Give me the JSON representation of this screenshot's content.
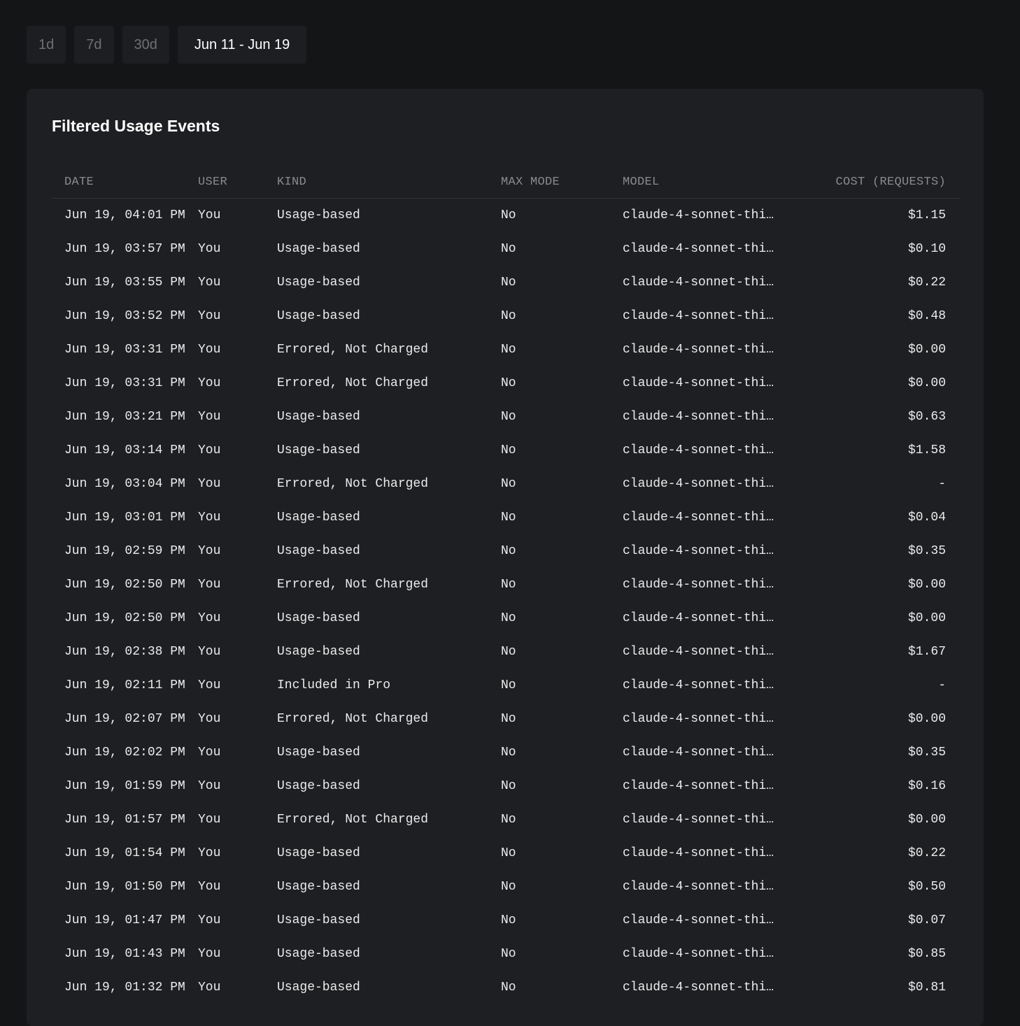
{
  "range_buttons": [
    {
      "label": "1d"
    },
    {
      "label": "7d"
    },
    {
      "label": "30d"
    },
    {
      "label": "Jun 11 - Jun 19"
    }
  ],
  "card": {
    "title": "Filtered Usage Events"
  },
  "table": {
    "headers": {
      "date": "DATE",
      "user": "USER",
      "kind": "KIND",
      "max_mode": "MAX MODE",
      "model": "MODEL",
      "cost": "COST (REQUESTS)"
    },
    "rows": [
      {
        "date": "Jun 19, 04:01 PM",
        "user": "You",
        "kind": "Usage-based",
        "max_mode": "No",
        "model": "claude-4-sonnet-thi…",
        "cost": "$1.15"
      },
      {
        "date": "Jun 19, 03:57 PM",
        "user": "You",
        "kind": "Usage-based",
        "max_mode": "No",
        "model": "claude-4-sonnet-thi…",
        "cost": "$0.10"
      },
      {
        "date": "Jun 19, 03:55 PM",
        "user": "You",
        "kind": "Usage-based",
        "max_mode": "No",
        "model": "claude-4-sonnet-thi…",
        "cost": "$0.22"
      },
      {
        "date": "Jun 19, 03:52 PM",
        "user": "You",
        "kind": "Usage-based",
        "max_mode": "No",
        "model": "claude-4-sonnet-thi…",
        "cost": "$0.48"
      },
      {
        "date": "Jun 19, 03:31 PM",
        "user": "You",
        "kind": "Errored, Not Charged",
        "max_mode": "No",
        "model": "claude-4-sonnet-thi…",
        "cost": "$0.00"
      },
      {
        "date": "Jun 19, 03:31 PM",
        "user": "You",
        "kind": "Errored, Not Charged",
        "max_mode": "No",
        "model": "claude-4-sonnet-thi…",
        "cost": "$0.00"
      },
      {
        "date": "Jun 19, 03:21 PM",
        "user": "You",
        "kind": "Usage-based",
        "max_mode": "No",
        "model": "claude-4-sonnet-thi…",
        "cost": "$0.63"
      },
      {
        "date": "Jun 19, 03:14 PM",
        "user": "You",
        "kind": "Usage-based",
        "max_mode": "No",
        "model": "claude-4-sonnet-thi…",
        "cost": "$1.58"
      },
      {
        "date": "Jun 19, 03:04 PM",
        "user": "You",
        "kind": "Errored, Not Charged",
        "max_mode": "No",
        "model": "claude-4-sonnet-thi…",
        "cost": "-"
      },
      {
        "date": "Jun 19, 03:01 PM",
        "user": "You",
        "kind": "Usage-based",
        "max_mode": "No",
        "model": "claude-4-sonnet-thi…",
        "cost": "$0.04"
      },
      {
        "date": "Jun 19, 02:59 PM",
        "user": "You",
        "kind": "Usage-based",
        "max_mode": "No",
        "model": "claude-4-sonnet-thi…",
        "cost": "$0.35"
      },
      {
        "date": "Jun 19, 02:50 PM",
        "user": "You",
        "kind": "Errored, Not Charged",
        "max_mode": "No",
        "model": "claude-4-sonnet-thi…",
        "cost": "$0.00"
      },
      {
        "date": "Jun 19, 02:50 PM",
        "user": "You",
        "kind": "Usage-based",
        "max_mode": "No",
        "model": "claude-4-sonnet-thi…",
        "cost": "$0.00"
      },
      {
        "date": "Jun 19, 02:38 PM",
        "user": "You",
        "kind": "Usage-based",
        "max_mode": "No",
        "model": "claude-4-sonnet-thi…",
        "cost": "$1.67"
      },
      {
        "date": "Jun 19, 02:11 PM",
        "user": "You",
        "kind": "Included in Pro",
        "max_mode": "No",
        "model": "claude-4-sonnet-thi…",
        "cost": "-"
      },
      {
        "date": "Jun 19, 02:07 PM",
        "user": "You",
        "kind": "Errored, Not Charged",
        "max_mode": "No",
        "model": "claude-4-sonnet-thi…",
        "cost": "$0.00"
      },
      {
        "date": "Jun 19, 02:02 PM",
        "user": "You",
        "kind": "Usage-based",
        "max_mode": "No",
        "model": "claude-4-sonnet-thi…",
        "cost": "$0.35"
      },
      {
        "date": "Jun 19, 01:59 PM",
        "user": "You",
        "kind": "Usage-based",
        "max_mode": "No",
        "model": "claude-4-sonnet-thi…",
        "cost": "$0.16"
      },
      {
        "date": "Jun 19, 01:57 PM",
        "user": "You",
        "kind": "Errored, Not Charged",
        "max_mode": "No",
        "model": "claude-4-sonnet-thi…",
        "cost": "$0.00"
      },
      {
        "date": "Jun 19, 01:54 PM",
        "user": "You",
        "kind": "Usage-based",
        "max_mode": "No",
        "model": "claude-4-sonnet-thi…",
        "cost": "$0.22"
      },
      {
        "date": "Jun 19, 01:50 PM",
        "user": "You",
        "kind": "Usage-based",
        "max_mode": "No",
        "model": "claude-4-sonnet-thi…",
        "cost": "$0.50"
      },
      {
        "date": "Jun 19, 01:47 PM",
        "user": "You",
        "kind": "Usage-based",
        "max_mode": "No",
        "model": "claude-4-sonnet-thi…",
        "cost": "$0.07"
      },
      {
        "date": "Jun 19, 01:43 PM",
        "user": "You",
        "kind": "Usage-based",
        "max_mode": "No",
        "model": "claude-4-sonnet-thi…",
        "cost": "$0.85"
      },
      {
        "date": "Jun 19, 01:32 PM",
        "user": "You",
        "kind": "Usage-based",
        "max_mode": "No",
        "model": "claude-4-sonnet-thi…",
        "cost": "$0.81"
      }
    ]
  }
}
